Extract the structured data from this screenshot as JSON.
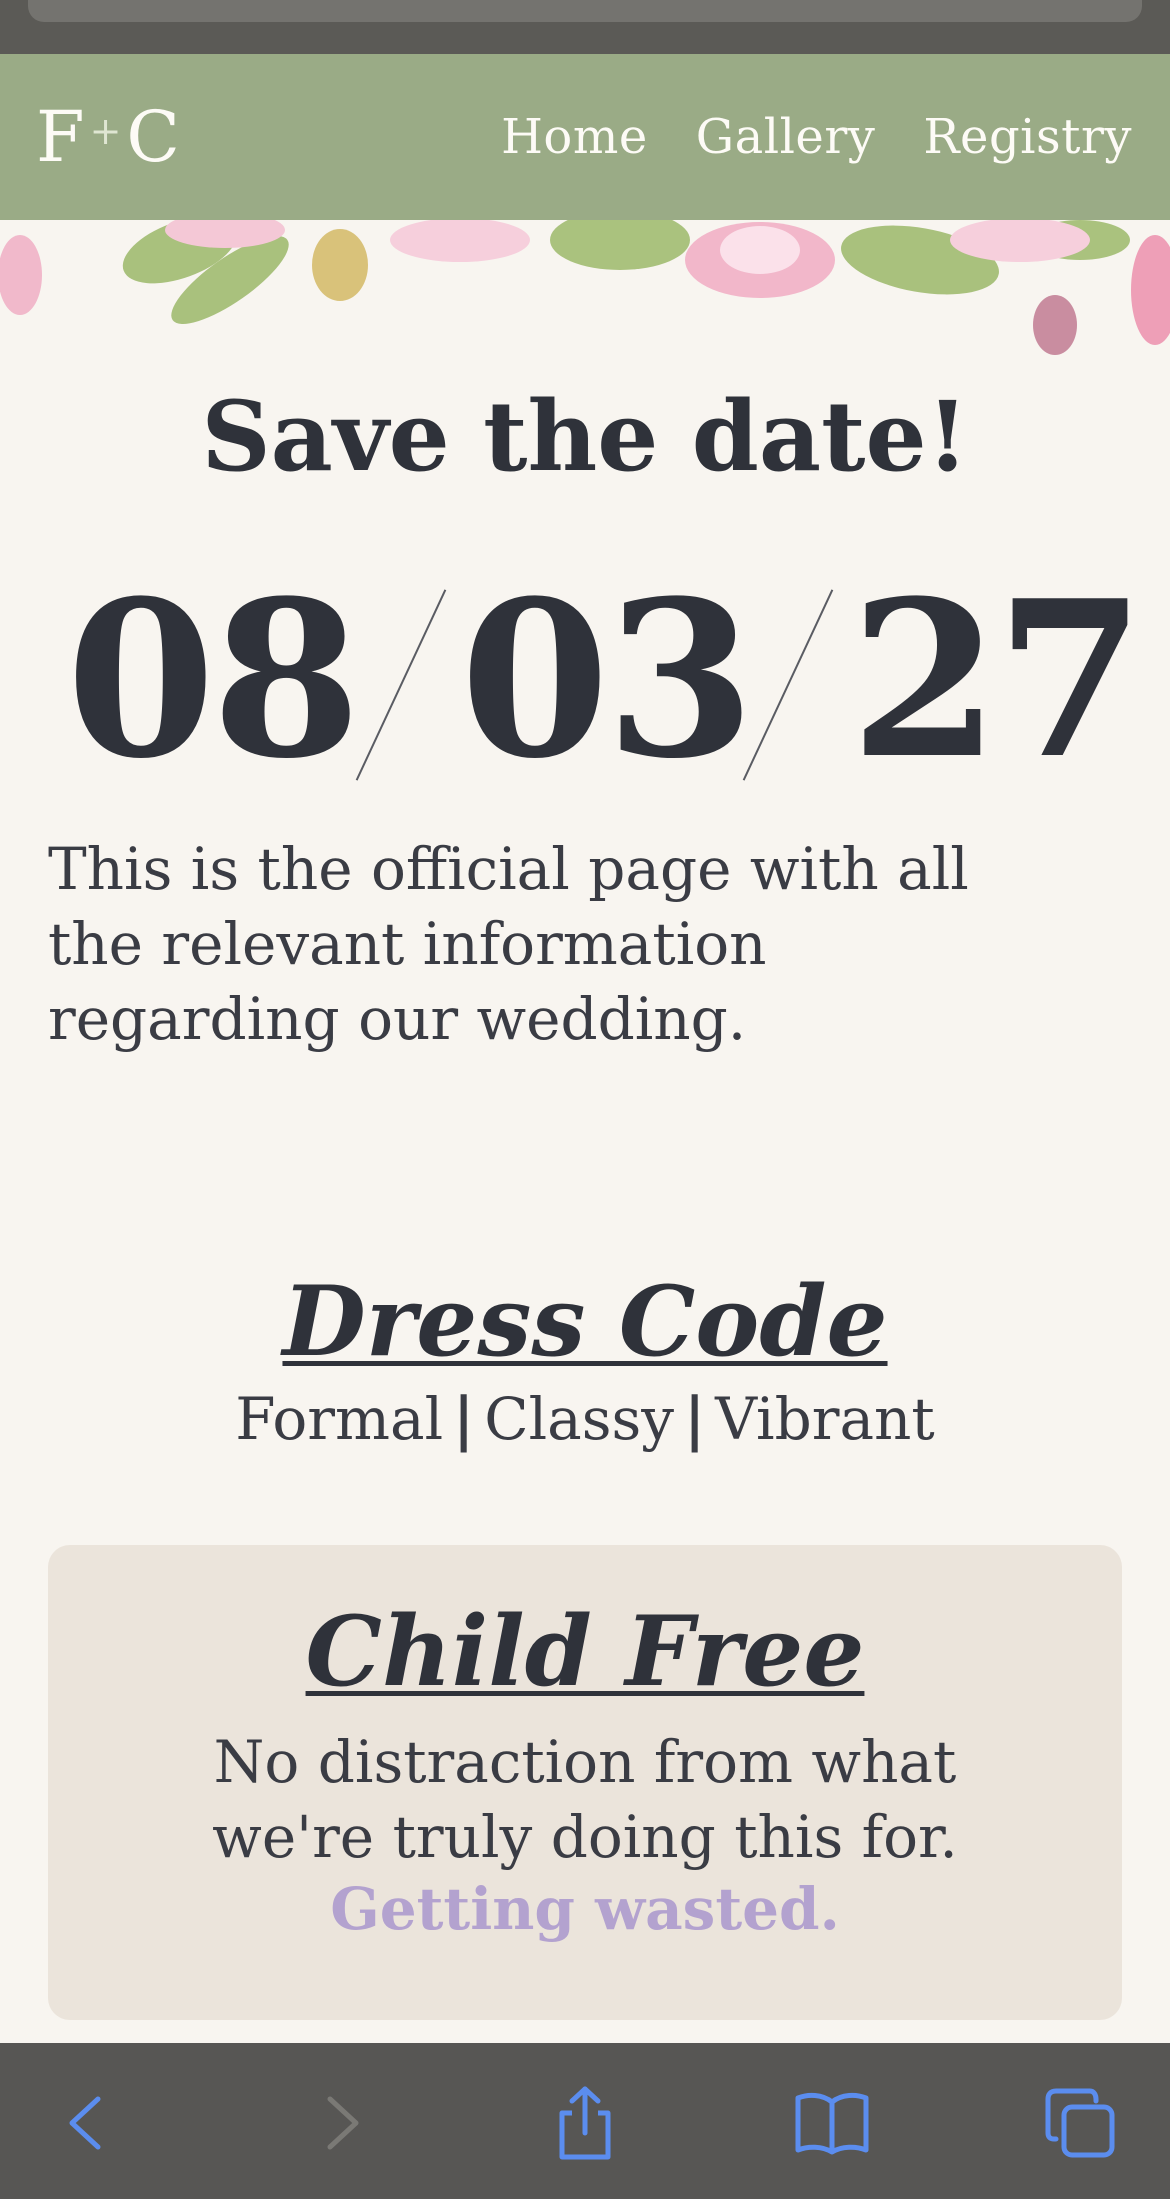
{
  "header": {
    "logo_left": "F",
    "logo_plus": "+",
    "logo_right": "C",
    "nav": [
      {
        "label": "Home"
      },
      {
        "label": "Gallery"
      },
      {
        "label": "Registry"
      }
    ]
  },
  "hero": {
    "title": "Save the date!",
    "date_parts": [
      "08",
      "03",
      "27"
    ],
    "intro": "This is the official page with all the relevant information regarding our wedding."
  },
  "dress_code": {
    "title": "Dress Code",
    "items": [
      "Formal",
      "Classy",
      "Vibrant"
    ],
    "separator": "|"
  },
  "child_free": {
    "title": "Child Free",
    "text": "No distraction from what we're truly doing this for.",
    "highlight": "Getting wasted."
  },
  "toolbar": {
    "icons": [
      "back-icon",
      "forward-icon",
      "share-icon",
      "bookmarks-icon",
      "tabs-icon"
    ],
    "accent_color": "#5b8def"
  },
  "colors": {
    "header_bg": "#9aab86",
    "page_bg": "#f8f5f0",
    "card_bg": "#ebe4db",
    "text": "#2f323a",
    "highlight": "#b3a2cf"
  }
}
